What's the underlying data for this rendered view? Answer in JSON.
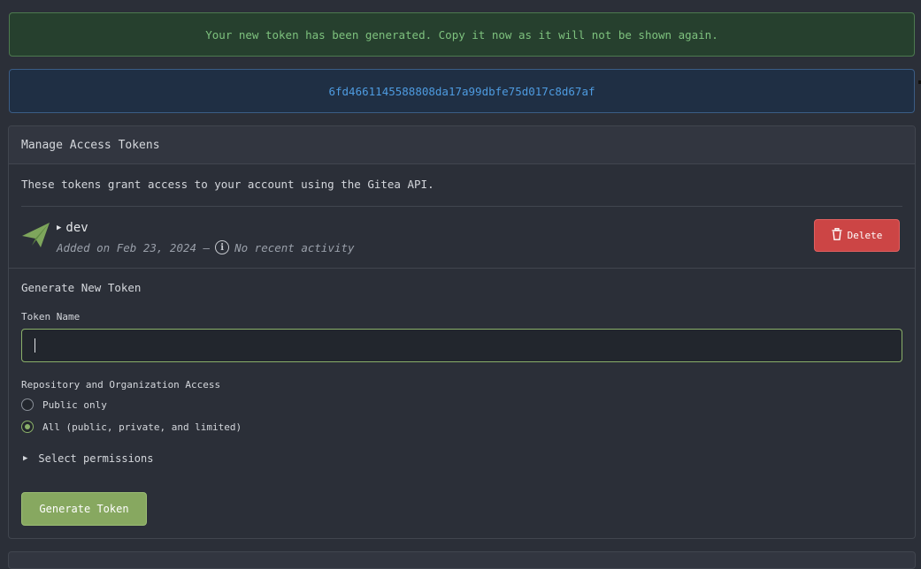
{
  "messages": {
    "success": "Your new token has been generated. Copy it now as it will not be shown again.",
    "token_value": "6fd4661145588808da17a99dbfe75d017c8d67af"
  },
  "panel": {
    "title": "Manage Access Tokens",
    "description": "These tokens grant access to your account using the Gitea API."
  },
  "tokens": [
    {
      "name": "dev",
      "added": "Added on Feb 23, 2024 —",
      "activity": "No recent activity",
      "delete_label": "Delete"
    }
  ],
  "generate": {
    "title": "Generate New Token",
    "name_label": "Token Name",
    "name_value": "",
    "access_label": "Repository and Organization Access",
    "options": [
      {
        "label": "Public only",
        "checked": false
      },
      {
        "label": "All (public, private, and limited)",
        "checked": true
      }
    ],
    "permissions_label": "Select permissions",
    "submit_label": "Generate Token"
  },
  "icons": {
    "token_icon": "paper-plane-icon",
    "info_icon": "info-icon",
    "delete_icon": "trash-icon",
    "expand_icon": "triangle-right-icon"
  },
  "colors": {
    "success_bg": "#26402e",
    "success_text": "#7ec27e",
    "info_bg": "#1f2f44",
    "info_text": "#4e9be0",
    "danger": "#cc4545",
    "primary": "#87a860"
  }
}
